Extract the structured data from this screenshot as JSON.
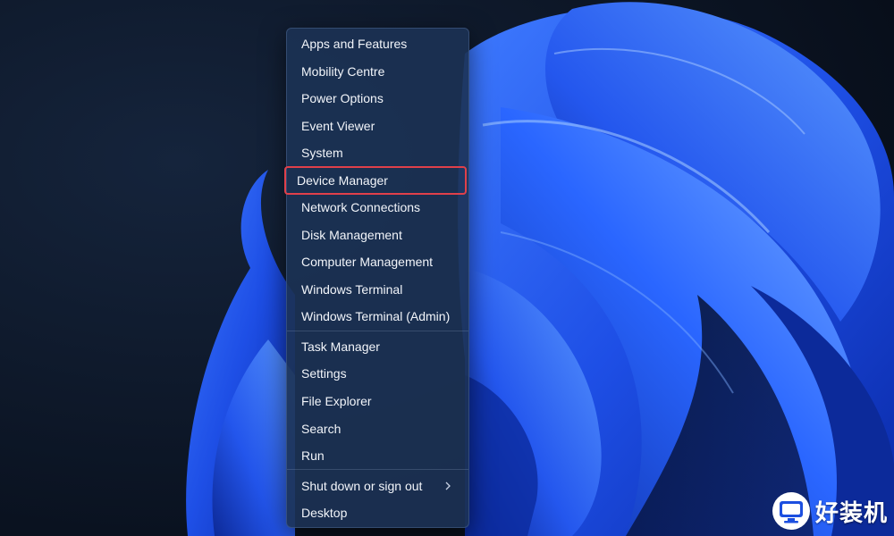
{
  "context_menu": {
    "items": [
      {
        "label": "Apps and Features"
      },
      {
        "label": "Mobility Centre"
      },
      {
        "label": "Power Options"
      },
      {
        "label": "Event Viewer"
      },
      {
        "label": "System"
      },
      {
        "label": "Device Manager",
        "highlighted": true
      },
      {
        "label": "Network Connections"
      },
      {
        "label": "Disk Management"
      },
      {
        "label": "Computer Management"
      },
      {
        "label": "Windows Terminal"
      },
      {
        "label": "Windows Terminal (Admin)"
      },
      {
        "label": "Task Manager"
      },
      {
        "label": "Settings"
      },
      {
        "label": "File Explorer"
      },
      {
        "label": "Search"
      },
      {
        "label": "Run"
      },
      {
        "label": "Shut down or sign out",
        "submenu_icon": "chevron-right-icon"
      },
      {
        "label": "Desktop"
      }
    ]
  },
  "watermark": {
    "text": "好装机",
    "icon": "monitor-logo-icon"
  },
  "colors": {
    "highlight_border": "#e0404a",
    "menu_background": "#1c3254",
    "wallpaper_blue": "#1f4fe0"
  }
}
